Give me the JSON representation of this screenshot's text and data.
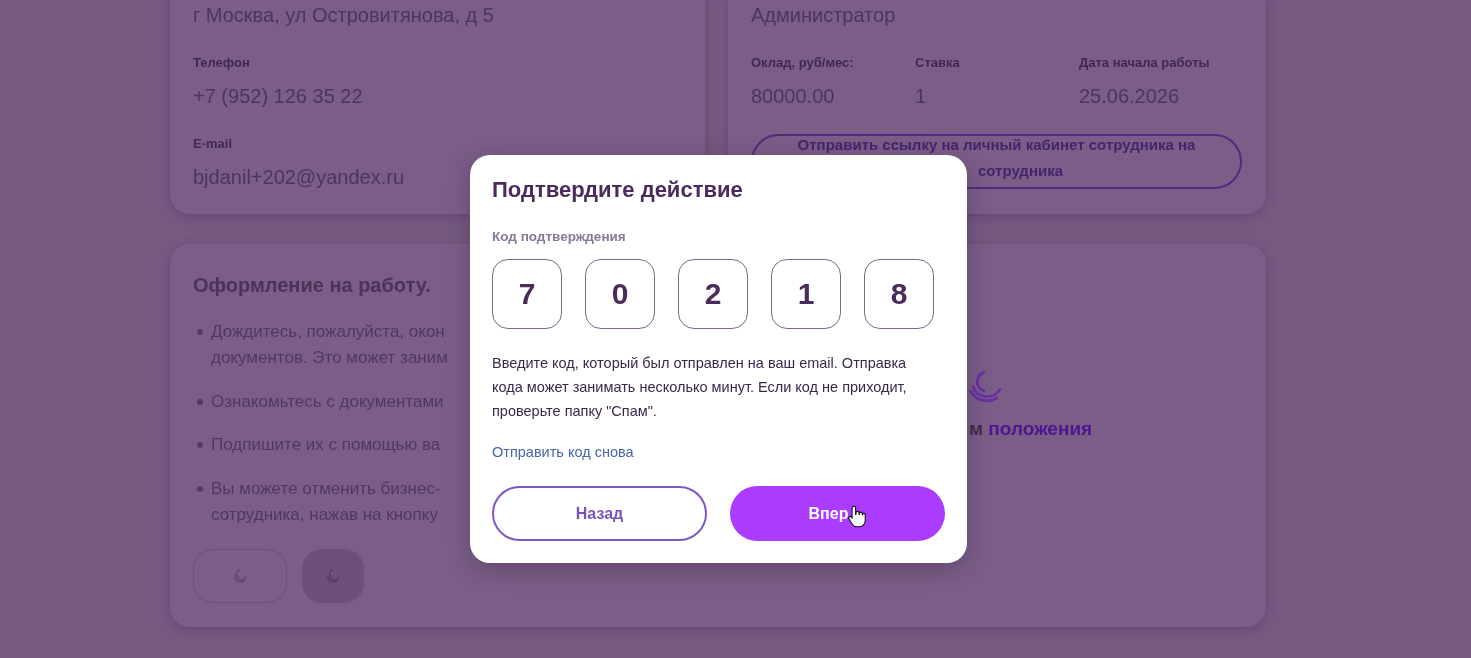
{
  "contact_card": {
    "address": "г Москва, ул Островитянова, д 5",
    "fields": [
      {
        "label": "Телефон",
        "value": "+7 (952) 126 35 22"
      },
      {
        "label": "E-mail",
        "value": "bjdanil+202@yandex.ru"
      }
    ]
  },
  "job_card": {
    "position": "Администратор",
    "fields": [
      {
        "label": "Оклад, руб/мес:",
        "value": "80000.00"
      },
      {
        "label": "Ставка",
        "value": "1"
      },
      {
        "label": "Дата начала работы",
        "value": "25.06.2026"
      }
    ],
    "send_link_button": {
      "lines": [
        "Отправить ссылку на личный кабинет сотрудника на",
        "сотрудника"
      ]
    }
  },
  "onboarding_card": {
    "title": "Оформление на работу.",
    "steps": [
      {
        "lines": [
          "Дождитесь, пожалуйста, окон",
          "документов. Это может заним"
        ]
      },
      {
        "lines": [
          "Ознакомьтесь с документами"
        ]
      },
      {
        "lines": [
          "Подпишите их с помощью ва"
        ]
      },
      {
        "lines": [
          "Вы можете отменить бизнес-",
          "сотрудника, нажав на кнопку"
        ]
      }
    ],
    "buttons": [
      {
        "kind": "outline",
        "loading": true
      },
      {
        "kind": "filled",
        "loading": true
      }
    ],
    "status": {
      "loading": true,
      "text": "м",
      "highlight": "положения"
    }
  },
  "dialog": {
    "title": "Подтвердите действие",
    "code_label": "Код подтверждения",
    "code_digits": [
      "7",
      "0",
      "2",
      "1",
      "8"
    ],
    "hint": "Введите код, который был отправлен на ваш email. Отправка кода может занимать несколько минут. Если код не приходит, проверьте папку \"Спам\".",
    "resend_link": "Отправить код снова",
    "buttons": [
      {
        "kind": "secondary",
        "label": "Назад"
      },
      {
        "kind": "primary",
        "label": "Впер"
      }
    ]
  }
}
